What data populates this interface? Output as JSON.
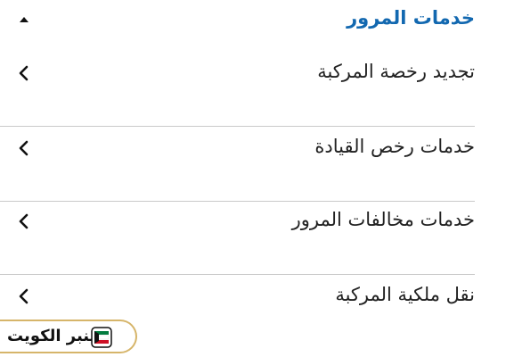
{
  "section": {
    "title": "خدمات المرور",
    "expanded": true,
    "collapse_icon": "caret-up-icon"
  },
  "items": [
    {
      "label": "تجديد رخصة المركبة",
      "icon": "chevron-left-icon"
    },
    {
      "label": "خدمات رخص القيادة",
      "icon": "chevron-left-icon"
    },
    {
      "label": "خدمات مخالفات المرور",
      "icon": "chevron-left-icon"
    },
    {
      "label": "نقل ملكية المركبة",
      "icon": "chevron-left-icon"
    }
  ],
  "watermark": {
    "text": "منبر الكويت"
  },
  "colors": {
    "accent": "#1268b0",
    "divider": "#c9c9c9",
    "text": "#222222",
    "watermark_border": "#d6b56a"
  }
}
